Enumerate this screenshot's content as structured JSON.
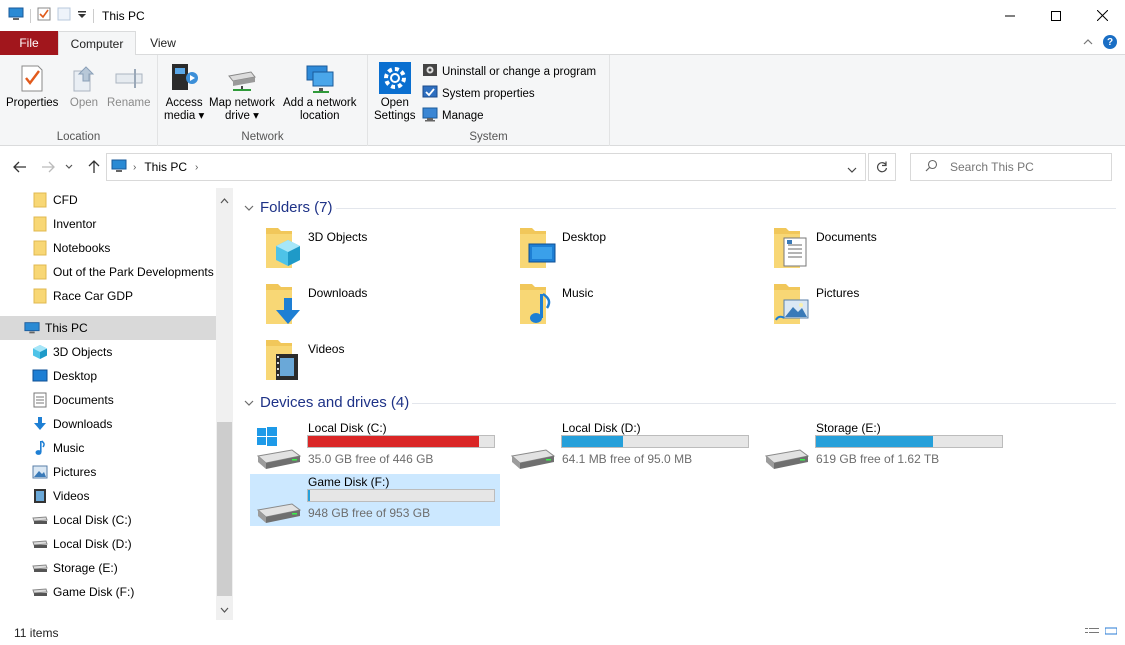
{
  "window": {
    "title": "This PC"
  },
  "ribbon_tabs": [
    {
      "label": "File"
    },
    {
      "label": "Computer"
    },
    {
      "label": "View"
    }
  ],
  "ribbon": {
    "location": {
      "label": "Location",
      "buttons": [
        {
          "label": "Properties",
          "enabled": true
        },
        {
          "label": "Open",
          "enabled": false
        },
        {
          "label": "Rename",
          "enabled": false
        }
      ]
    },
    "network": {
      "label": "Network",
      "buttons": [
        {
          "line1": "Access",
          "line2": "media ▾"
        },
        {
          "line1": "Map network",
          "line2": "drive ▾"
        },
        {
          "line1": "Add a network",
          "line2": "location"
        }
      ]
    },
    "system": {
      "label": "System",
      "open_settings": {
        "line1": "Open",
        "line2": "Settings"
      },
      "small_buttons": [
        {
          "label": "Uninstall or change a program"
        },
        {
          "label": "System properties"
        },
        {
          "label": "Manage"
        }
      ]
    }
  },
  "address": {
    "crumbs": [
      "This PC"
    ],
    "search_placeholder": "Search This PC"
  },
  "navpane": {
    "items": [
      {
        "label": "CFD",
        "icon": "folder-icon"
      },
      {
        "label": "Inventor",
        "icon": "folder-icon"
      },
      {
        "label": "Notebooks",
        "icon": "folder-icon"
      },
      {
        "label": "Out of the Park Developments",
        "icon": "folder-icon"
      },
      {
        "label": "Race Car GDP",
        "icon": "folder-icon"
      },
      {
        "label": "This PC",
        "icon": "computer-icon",
        "selected": true
      },
      {
        "label": "3D Objects",
        "icon": "3d-objects-icon"
      },
      {
        "label": "Desktop",
        "icon": "desktop-icon"
      },
      {
        "label": "Documents",
        "icon": "documents-icon"
      },
      {
        "label": "Downloads",
        "icon": "downloads-icon"
      },
      {
        "label": "Music",
        "icon": "music-icon"
      },
      {
        "label": "Pictures",
        "icon": "pictures-icon"
      },
      {
        "label": "Videos",
        "icon": "videos-icon"
      },
      {
        "label": "Local Disk (C:)",
        "icon": "drive-icon"
      },
      {
        "label": "Local Disk (D:)",
        "icon": "drive-icon"
      },
      {
        "label": "Storage (E:)",
        "icon": "drive-icon"
      },
      {
        "label": "Game Disk (F:)",
        "icon": "drive-icon"
      }
    ]
  },
  "folders": {
    "heading": "Folders (7)",
    "items": [
      {
        "label": "3D Objects",
        "icon": "3d-objects-icon"
      },
      {
        "label": "Desktop",
        "icon": "desktop-icon"
      },
      {
        "label": "Documents",
        "icon": "documents-icon"
      },
      {
        "label": "Downloads",
        "icon": "downloads-icon"
      },
      {
        "label": "Music",
        "icon": "music-icon"
      },
      {
        "label": "Pictures",
        "icon": "pictures-icon"
      },
      {
        "label": "Videos",
        "icon": "videos-icon"
      }
    ]
  },
  "drives": {
    "heading": "Devices and drives (4)",
    "items": [
      {
        "label": "Local Disk (C:)",
        "free": "35.0 GB free of 446 GB",
        "used_fraction": 0.92,
        "bar_color": "#da2626",
        "selected": false
      },
      {
        "label": "Local Disk (D:)",
        "free": "64.1 MB free of 95.0 MB",
        "used_fraction": 0.33,
        "bar_color": "#26a0da",
        "selected": false
      },
      {
        "label": "Storage (E:)",
        "free": "619 GB free of 1.62 TB",
        "used_fraction": 0.63,
        "bar_color": "#26a0da",
        "selected": false
      },
      {
        "label": "Game Disk (F:)",
        "free": "948 GB free of 953 GB",
        "used_fraction": 0.01,
        "bar_color": "#26a0da",
        "selected": true
      }
    ]
  },
  "status": {
    "items_count": "11 items"
  },
  "colors": {
    "file_tab": "#a1161c",
    "folder_yellow": "#f8d775",
    "accent_blue": "#0078d7",
    "heading_blue": "#1e3287",
    "selection": "#cce8ff"
  }
}
